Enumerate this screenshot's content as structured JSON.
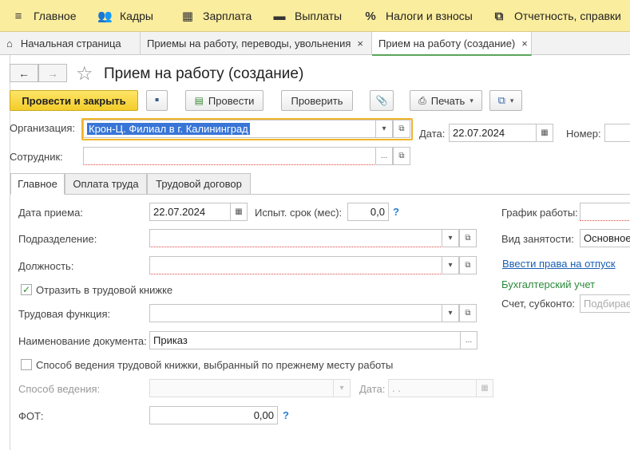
{
  "topnav": [
    {
      "icon": "≡",
      "label": "Главное"
    },
    {
      "icon": "👥",
      "label": "Кадры"
    },
    {
      "icon": "▦",
      "label": "Зарплата"
    },
    {
      "icon": "▬",
      "label": "Выплаты"
    },
    {
      "icon": "%",
      "label": "Налоги и взносы"
    },
    {
      "icon": "⧉",
      "label": "Отчетность, справки"
    }
  ],
  "tabs": [
    {
      "label": "Начальная страница"
    },
    {
      "label": "Приемы на работу, переводы, увольнения",
      "close": "×"
    },
    {
      "label": "Прием на работу (создание)",
      "close": "×"
    }
  ],
  "nav": {
    "back": "←",
    "forward": "→",
    "star": "☆"
  },
  "title": "Прием на работу (создание)",
  "toolbar": {
    "post_close": "Провести и закрыть",
    "save_icon": "▪",
    "post": "Провести",
    "check": "Проверить",
    "attach_icon": "📎",
    "print": "Печать",
    "print_icon": "⎙",
    "more_icon": "⧉",
    "dropdown": "▾"
  },
  "header": {
    "org_label": "Организация:",
    "org_value": "Крон-Ц. Филиал в г. Калининград",
    "date_label": "Дата:",
    "date_value": "22.07.2024",
    "number_label": "Номер:",
    "employee_label": "Сотрудник:",
    "dd": "▾",
    "open": "⧉",
    "dots": "...",
    "cal": "▦"
  },
  "form_tabs": [
    "Главное",
    "Оплата труда",
    "Трудовой договор"
  ],
  "main": {
    "hire_date_label": "Дата приема:",
    "hire_date_value": "22.07.2024",
    "probation_label": "Испыт. срок (мес):",
    "probation_value": "0,0",
    "help": "?",
    "schedule_label": "График работы:",
    "department_label": "Подразделение:",
    "employment_type_label": "Вид занятости:",
    "employment_type_value": "Основное",
    "position_label": "Должность:",
    "leave_rights_link": "Ввести права на отпуск",
    "workbook_label": "Отразить в трудовой книжке",
    "check_mark": "✓",
    "accounting_title": "Бухгалтерский учет",
    "account_label": "Счет, субконто:",
    "account_placeholder": "Подбирается",
    "labor_function_label": "Трудовая функция:",
    "doc_name_label": "Наименование документа:",
    "doc_name_value": "Приказ",
    "previous_method_label": "Способ ведения трудовой книжки, выбранный по прежнему месту работы",
    "method_label": "Способ ведения:",
    "method_date_label": "Дата:",
    "method_date_value": " .  .",
    "fot_label": "ФОТ:",
    "fot_value": "0,00"
  }
}
